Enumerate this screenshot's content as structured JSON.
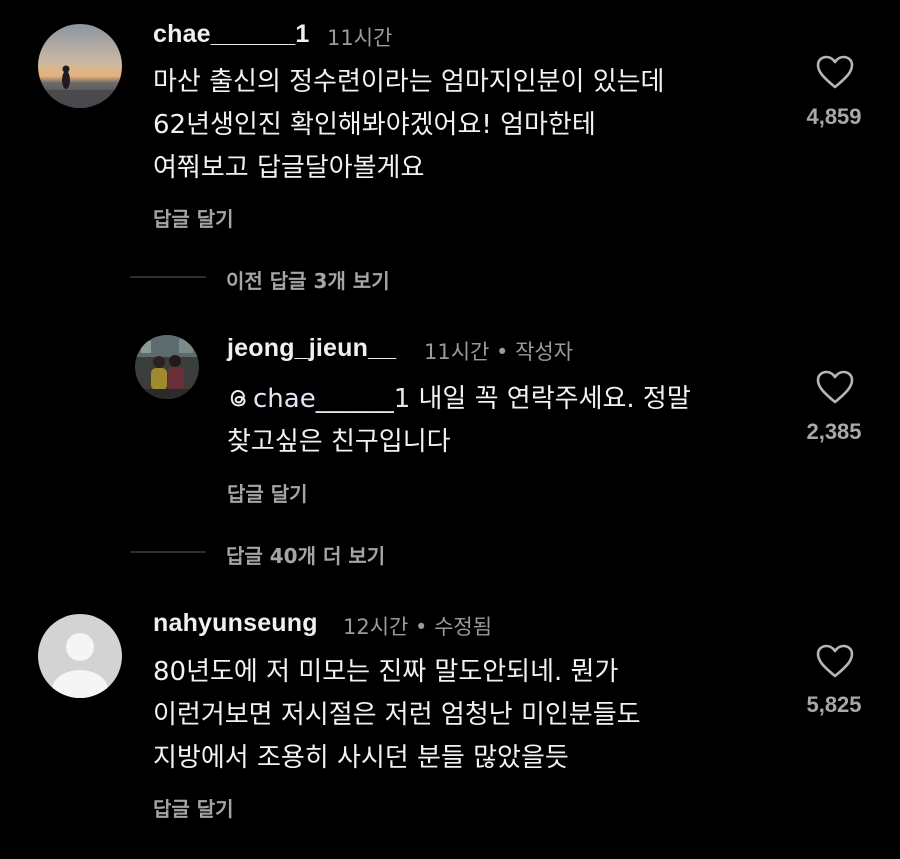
{
  "comments": [
    {
      "username": "chae______1",
      "meta": "11시간",
      "lines": [
        "마산 출신의 정수련이라는 엄마지인분이 있는데",
        "62년생인진 확인해봐야겠어요! 엄마한테",
        "여쭤보고 답글달아볼게요"
      ],
      "reply_label": "답글 달기",
      "likes": "4,859",
      "avatar": "sunset-photo-avatar"
    },
    {
      "username": "jeong_jieun__",
      "meta": "11시간 • 작성자",
      "mention_icon": "threads-icon",
      "mention": "chae______1",
      "line1_rest": " 내일 꼭 연락주세요. 정말",
      "line2": "찾고싶은 친구입니다",
      "reply_label": "답글 달기",
      "likes": "2,385",
      "avatar": "two-people-photo-avatar"
    },
    {
      "username": "nahyunseung",
      "meta": "12시간 • 수정됨",
      "lines": [
        "80년도에 저 미모는 진짜 말도안되네. 뭔가",
        "이런거보면 저시절은 저런 엄청난 미인분들도",
        "지방에서 조용히 사시던 분들 많았을듯"
      ],
      "reply_label": "답글 달기",
      "likes": "5,825",
      "avatar": "default-user-avatar"
    }
  ],
  "thread_links": {
    "previous_replies": "이전 답글 3개 보기",
    "more_replies": "답글 40개 더 보기"
  },
  "colors": {
    "background": "#000000",
    "text": "#f2f2f2",
    "secondary": "#9a9a9a"
  }
}
